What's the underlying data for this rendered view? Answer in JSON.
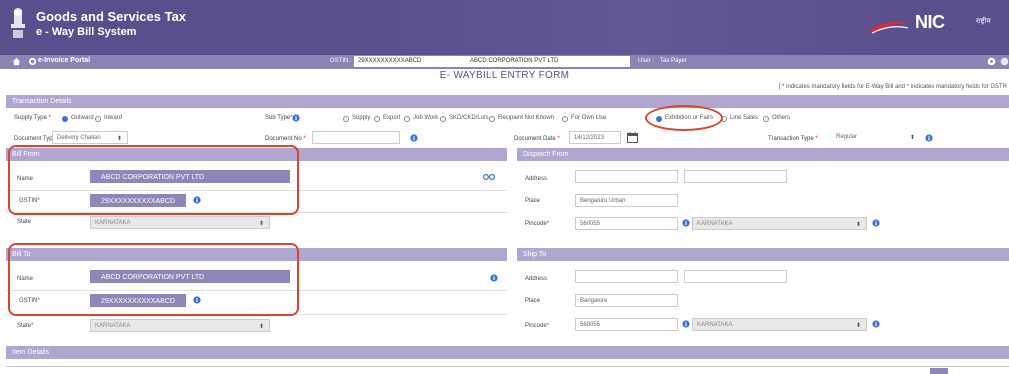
{
  "header": {
    "title_line1": "Goods and Services Tax",
    "title_line2": "e - Way Bill System",
    "nic_text": "NIC",
    "nic_sub": "राष्ट्रीय"
  },
  "nav": {
    "portal_label": "e-Invoice Portal",
    "gstin_label": "GSTIN :",
    "gstin_value": "29XXXXXXXXXXABCD",
    "corp_name": "ABCD CORPORATION PVT LTD",
    "user_label": "User :",
    "user_value": "Tax Payer"
  },
  "form": {
    "title": "E- WAYBILL ENTRY FORM",
    "mandatory_note": "indicates mandatory fields for E-Way Bill and * indicates mandatory fields for GSTR"
  },
  "transaction": {
    "section_title": "Transaction Details",
    "supply_type_label": "Supply Type",
    "supply_type_options": [
      "Outward",
      "Inward"
    ],
    "sub_type_label": "Sub Type",
    "sub_type_options": [
      "Supply",
      "Export",
      "Job Work",
      "SKD/CKD/Lots",
      "Recipient Not Known",
      "For Own Use",
      "Exhibition or Fairs",
      "Line Sales",
      "Others"
    ],
    "doc_type_label": "Document Type",
    "doc_type_value": "Delivery Challan",
    "doc_no_label": "Document No",
    "doc_date_label": "Document Date",
    "doc_date_value": "14/12/2023",
    "txn_type_label": "Transaction Type",
    "txn_type_value": "Regular"
  },
  "bill_from": {
    "section_title": "Bill From",
    "name_label": "Name",
    "name_value": "ABCD CORPORATION PVT LTD",
    "gstin_label": "GSTIN",
    "gstin_value": "29XXXXXXXXXXABCD",
    "state_label": "State",
    "state_value": "KARNATAKA"
  },
  "dispatch_from": {
    "section_title": "Dispatch From",
    "address_label": "Address",
    "place_label": "Place",
    "place_value": "Bengaluru Urban",
    "pincode_label": "Pincode",
    "pincode_value": "560055",
    "state_value": "KARNATAKA"
  },
  "bill_to": {
    "section_title": "Bill To",
    "name_label": "Name",
    "name_value": "ABCD CORPORATION PVT LTD",
    "gstin_label": "GSTIN",
    "gstin_value": "29XXXXXXXXXXABCD",
    "state_label": "State",
    "state_value": "KARNATAKA"
  },
  "ship_to": {
    "section_title": "Ship To",
    "address_label": "Address",
    "place_label": "Place",
    "place_value": "Bangalore",
    "pincode_label": "Pincode",
    "pincode_value": "560055",
    "state_value": "KARNATAKA"
  },
  "items": {
    "section_title": "Item Details"
  },
  "icons": {
    "home": "home-icon",
    "info": "info-icon",
    "calendar": "calendar-icon",
    "search": "search-icon",
    "dropdown": "chevron-down-icon"
  },
  "colors": {
    "header": "#5a4e8c",
    "nav": "#8d84b6",
    "section_bar": "#b0a6d0",
    "highlight_field": "#8e86b8",
    "annotation": "#d9462b",
    "radio_selected": "#3a6fd8"
  }
}
